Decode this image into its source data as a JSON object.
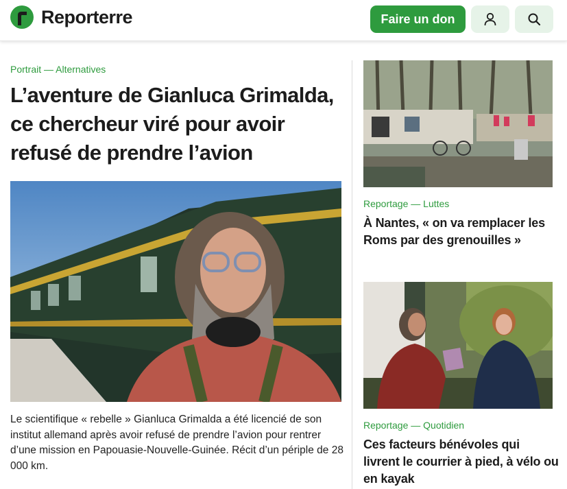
{
  "header": {
    "logo_text": "Reporterre",
    "donate_label": "Faire un don",
    "account_icon": "user-icon",
    "search_icon": "search-icon",
    "colors": {
      "brand_green": "#2e9b3e",
      "icon_button_bg": "#e6f3e8"
    }
  },
  "main_story": {
    "kicker": "Portrait — Alternatives",
    "title": "L’aventure de Gianluca Grimalda, ce chercheur viré pour avoir refusé de prendre l’avion",
    "lede": "Le scientifique « rebelle » Gianluca Grimalda a été licencié de son institut allemand après avoir refusé de prendre l’avion pour rentrer d’une mission en Papouasie-Nouvelle-Guinée. Récit d’un périple de 28 000 km."
  },
  "side_stories": [
    {
      "kicker": "Reportage — Luttes",
      "title": "À Nantes, « on va remplacer les Roms par des grenouilles »"
    },
    {
      "kicker": "Reportage — Quotidien",
      "title": "Ces facteurs bénévoles qui livrent le courrier à pied, à vélo ou en kayak"
    }
  ]
}
